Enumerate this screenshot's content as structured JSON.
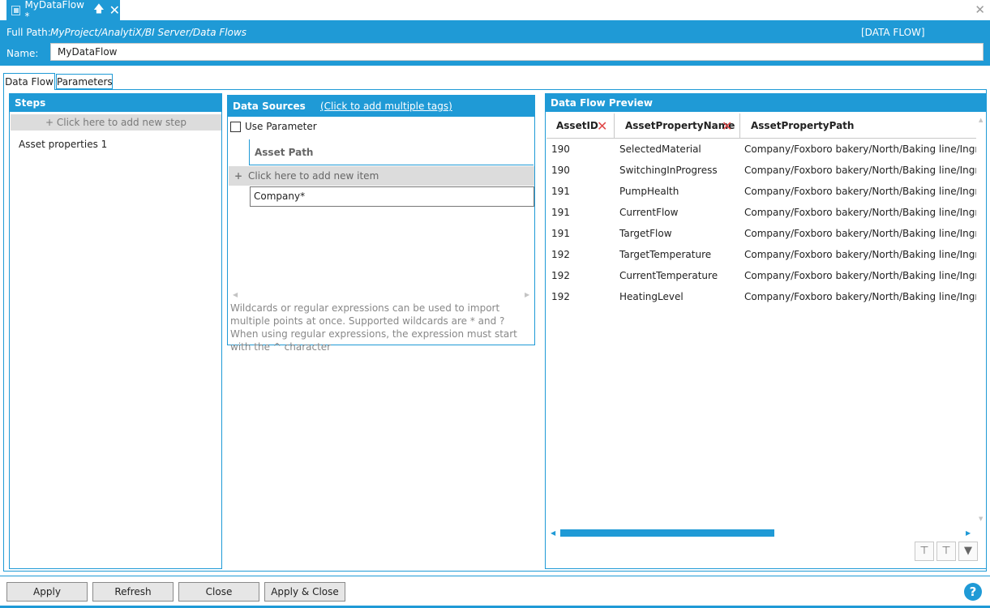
{
  "doc_tab": {
    "title": "MyDataFlow *"
  },
  "header": {
    "full_path_label": "Full Path:",
    "full_path_value": "MyProject/AnalytiX/BI Server/Data Flows",
    "type_badge": "[DATA FLOW]",
    "name_label": "Name:",
    "name_value": "MyDataFlow"
  },
  "tabs": [
    {
      "label": "Data Flow"
    },
    {
      "label": "Parameters"
    }
  ],
  "steps": {
    "title": "Steps",
    "add_label": "+ Click here to add new step",
    "items": [
      {
        "label": "Asset properties  1"
      }
    ]
  },
  "data_sources": {
    "title": "Data Sources",
    "add_tags_link": "(Click to add multiple tags)",
    "use_parameter_label": "Use Parameter",
    "use_parameter_checked": false,
    "column_header": "Asset Path",
    "add_item_label": "Click here to add new item",
    "rows": [
      "Company*"
    ],
    "hint": "Wildcards or regular expressions can be used to import multiple points at once. Supported wildcards are * and ? When using regular expressions, the expression must start with the ^ character"
  },
  "preview": {
    "title": "Data Flow Preview",
    "columns": [
      "AssetID",
      "AssetPropertyName",
      "AssetPropertyPath"
    ],
    "rows": [
      [
        "190",
        "SelectedMaterial",
        "Company/Foxboro bakery/North/Baking line/Ingredie"
      ],
      [
        "190",
        "SwitchingInProgress",
        "Company/Foxboro bakery/North/Baking line/Ingredie"
      ],
      [
        "191",
        "PumpHealth",
        "Company/Foxboro bakery/North/Baking line/Ingredie"
      ],
      [
        "191",
        "CurrentFlow",
        "Company/Foxboro bakery/North/Baking line/Ingredie"
      ],
      [
        "191",
        "TargetFlow",
        "Company/Foxboro bakery/North/Baking line/Ingredie"
      ],
      [
        "192",
        "TargetTemperature",
        "Company/Foxboro bakery/North/Baking line/Ingredie"
      ],
      [
        "192",
        "CurrentTemperature",
        "Company/Foxboro bakery/North/Baking line/Ingredie"
      ],
      [
        "192",
        "HeatingLevel",
        "Company/Foxboro bakery/North/Baking line/Ingredie"
      ]
    ]
  },
  "footer": {
    "apply": "Apply",
    "refresh": "Refresh",
    "close": "Close",
    "apply_close": "Apply & Close",
    "help": "?"
  },
  "colors": {
    "accent": "#1f9ad6",
    "delete": "#e04848",
    "row_gray": "#dcdcdc"
  }
}
